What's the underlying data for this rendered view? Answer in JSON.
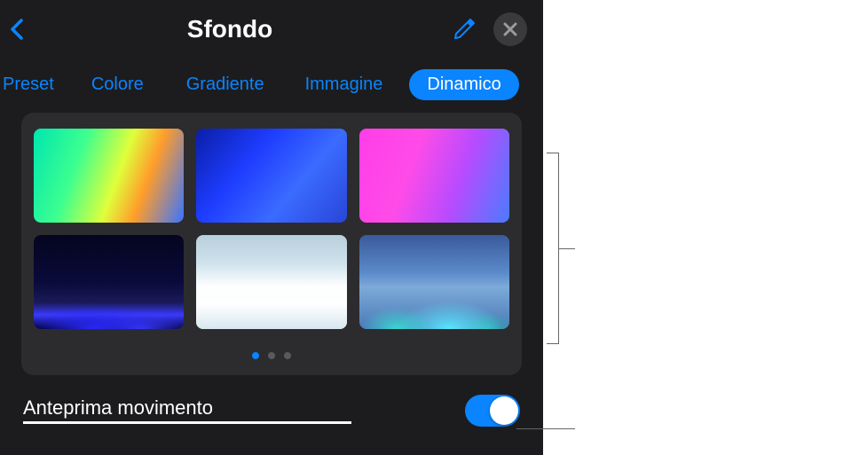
{
  "header": {
    "title": "Sfondo"
  },
  "tabs": {
    "items": [
      {
        "label": "Preset",
        "active": false
      },
      {
        "label": "Colore",
        "active": false
      },
      {
        "label": "Gradiente",
        "active": false
      },
      {
        "label": "Immagine",
        "active": false
      },
      {
        "label": "Dinamico",
        "active": true
      }
    ]
  },
  "presets": {
    "items": [
      {
        "name": "rainbow-gradient"
      },
      {
        "name": "blue-gradient"
      },
      {
        "name": "pink-purple-gradient"
      },
      {
        "name": "dark-night-landscape"
      },
      {
        "name": "light-snow-landscape"
      },
      {
        "name": "blue-teal-landscape"
      }
    ],
    "pageCount": 3,
    "activePage": 0
  },
  "previewMotion": {
    "label": "Anteprima movimento",
    "enabled": true
  },
  "colors": {
    "accent": "#0a84ff",
    "panelBg": "#1c1c1e",
    "cardBg": "#2c2c2e"
  }
}
